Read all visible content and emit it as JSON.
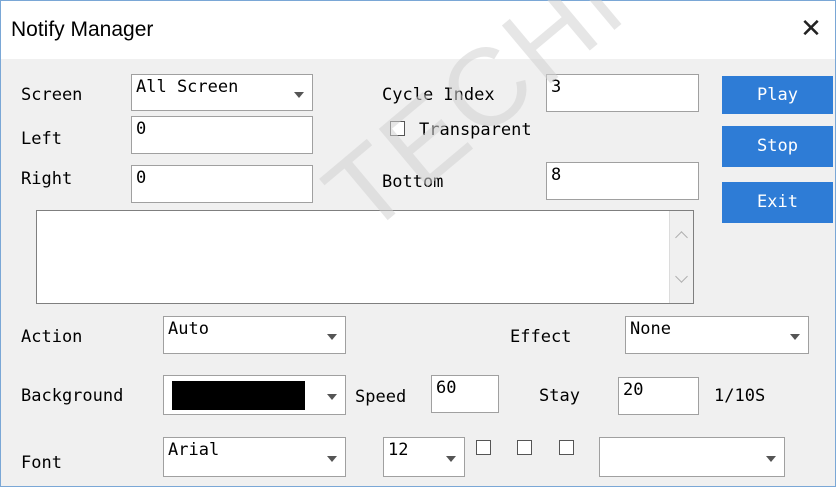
{
  "window": {
    "title": "Notify Manager",
    "close_glyph": "✕"
  },
  "screen": {
    "label": "Screen",
    "value": "All Screen"
  },
  "left": {
    "label": "Left",
    "value": "0"
  },
  "right": {
    "label": "Right",
    "value": "0"
  },
  "cycle_index": {
    "label": "Cycle Index",
    "value": "3"
  },
  "transparent": {
    "label": "Transparent",
    "checked": false
  },
  "bottom": {
    "label": "Bottom",
    "value": "8"
  },
  "buttons": {
    "play": "Play",
    "stop": "Stop",
    "exit": "Exit"
  },
  "message": {
    "value": ""
  },
  "action": {
    "label": "Action",
    "value": "Auto"
  },
  "effect": {
    "label": "Effect",
    "value": "None"
  },
  "background": {
    "label": "Background",
    "color": "#000000"
  },
  "speed": {
    "label": "Speed",
    "value": "60"
  },
  "stay": {
    "label": "Stay",
    "value": "20",
    "unit": "1/10S"
  },
  "font": {
    "label": "Font",
    "family": "Arial",
    "size": "12",
    "style_value": ""
  },
  "colors": {
    "accent_button": "#2e7cd6",
    "window_border": "#7aa7d6",
    "client_bg": "#f0f0f0"
  },
  "watermark": {
    "text": "TECHNOLOG"
  }
}
